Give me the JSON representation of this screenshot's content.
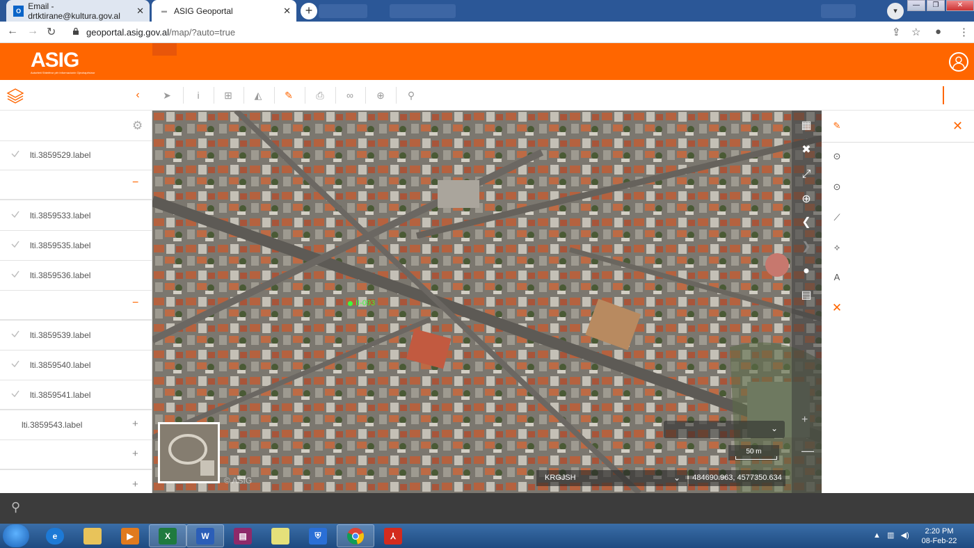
{
  "browser": {
    "tabs": [
      {
        "title": "Email - drtktirane@kultura.gov.al",
        "icon": "outlook-icon"
      },
      {
        "title": "ASIG Geoportal",
        "icon": "asig-favicon"
      }
    ],
    "url_host": "geoportal.asig.gov.al",
    "url_path": "/map/?auto=true"
  },
  "header": {
    "logo_text": "ASIG",
    "logo_subtitle": "Autoriteti Shtetëror për Informacionin Gjeohapësinor",
    "accent_color": "#ff6600"
  },
  "layers": {
    "items": [
      {
        "label": "lti.3859529.label",
        "checked": true
      },
      {
        "label": "",
        "group": true,
        "toggle": "−"
      },
      {
        "label": "lti.3859533.label",
        "checked": true
      },
      {
        "label": "lti.3859535.label",
        "checked": true
      },
      {
        "label": "lti.3859536.label",
        "checked": true
      },
      {
        "label": "",
        "group": true,
        "toggle": "−"
      },
      {
        "label": "lti.3859539.label",
        "checked": true
      },
      {
        "label": "lti.3859540.label",
        "checked": true
      },
      {
        "label": "lti.3859541.label",
        "checked": true
      },
      {
        "label": "lti.3859543.label",
        "checked": false,
        "toggle": "+"
      },
      {
        "label": "",
        "toggle": "+"
      },
      {
        "label": "",
        "toggle": "+"
      }
    ]
  },
  "map": {
    "marker_label": "II-093",
    "watermark": "© ASIG",
    "scale_label": "50 m",
    "crs": "KRGJSH",
    "coordinates": "484690.963, 4577350.634"
  },
  "taskbar": {
    "time": "2:20 PM",
    "date": "08-Feb-22"
  }
}
